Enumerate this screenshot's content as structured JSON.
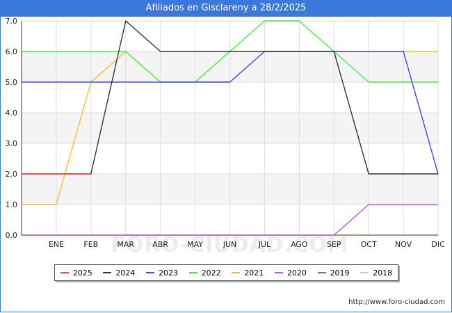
{
  "title": "Afiliados en Gisclareny a 28/2/2025",
  "watermark": "FORO-CIUDAD.COM",
  "footer": "http://www.foro-ciudad.com",
  "chart_data": {
    "type": "line",
    "title": "Afiliados en Gisclareny a 28/2/2025",
    "categories": [
      "",
      "ENE",
      "FEB",
      "MAR",
      "ABR",
      "MAY",
      "JUN",
      "JUL",
      "AGO",
      "SEP",
      "OCT",
      "NOV",
      "DIC"
    ],
    "ylim": [
      0,
      7
    ],
    "yticks": [
      "0.0",
      "1.0",
      "2.0",
      "3.0",
      "4.0",
      "5.0",
      "6.0",
      "7.0"
    ],
    "grid": true,
    "legend_position": "bottom",
    "series": [
      {
        "name": "2025",
        "color": "#ff4444",
        "values": [
          2,
          2,
          2
        ]
      },
      {
        "name": "2024",
        "color": "#333333",
        "values": [
          2,
          2,
          2,
          7,
          6,
          6,
          6,
          6,
          6,
          6,
          2,
          2,
          2
        ]
      },
      {
        "name": "2023",
        "color": "#4444ff",
        "values": [
          5,
          5,
          5,
          5,
          5,
          5,
          5,
          6,
          6,
          6,
          6,
          6,
          2
        ]
      },
      {
        "name": "2022",
        "color": "#44ee44",
        "values": [
          6,
          6,
          6,
          6,
          5,
          5,
          6,
          7,
          7,
          6,
          5,
          5,
          5
        ]
      },
      {
        "name": "2021",
        "color": "#ffb833",
        "values": [
          1,
          1,
          5,
          6,
          5,
          5,
          5,
          6,
          6,
          6,
          6,
          6,
          6
        ]
      },
      {
        "name": "2020",
        "color": "#bb55ee",
        "values": [
          0,
          0,
          0,
          0,
          0,
          0,
          0,
          0,
          0,
          0,
          1,
          1,
          1
        ]
      },
      {
        "name": "2019",
        "color": "#aa6644",
        "values": [
          0,
          0,
          0,
          0,
          0,
          0,
          0,
          0,
          0,
          0,
          0,
          0,
          0
        ]
      },
      {
        "name": "2018",
        "color": "#cccccc",
        "values": []
      }
    ]
  }
}
